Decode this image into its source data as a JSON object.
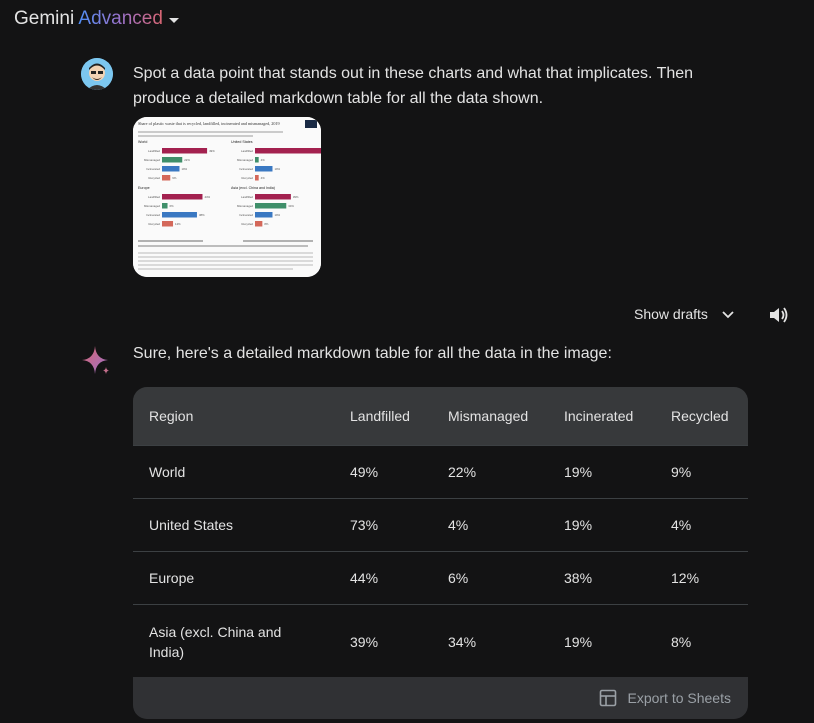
{
  "header": {
    "brand": "Gemini",
    "brand_advanced": "Advanced"
  },
  "prompt": {
    "text": "Spot a data point that stands out in these charts and what that implicates. Then produce a detailed markdown table for all the data shown."
  },
  "thumbnail": {
    "title": "Share of plastic waste that is recycled, landfilled, incinerated and mismanaged, 2019",
    "panels": [
      {
        "name": "World",
        "values": [
          49,
          22,
          19,
          9
        ]
      },
      {
        "name": "United States",
        "values": [
          73,
          4,
          19,
          4
        ]
      },
      {
        "name": "Europe",
        "values": [
          44,
          6,
          38,
          12
        ]
      },
      {
        "name": "Asia (excl. China and India)",
        "values": [
          39,
          34,
          19,
          8
        ]
      }
    ],
    "row_labels": [
      "Landfilled",
      "Mismanaged",
      "Incinerated",
      "Recycled"
    ],
    "colors": [
      "#a3214f",
      "#3f8f6a",
      "#3a78c2",
      "#d4685a"
    ]
  },
  "drafts": {
    "label": "Show drafts"
  },
  "response": {
    "text": "Sure, here's a detailed markdown table for all the data in the image:"
  },
  "table": {
    "headers": [
      "Region",
      "Landfilled",
      "Mismanaged",
      "Incinerated",
      "Recycled"
    ],
    "rows": [
      [
        "World",
        "49%",
        "22%",
        "19%",
        "9%"
      ],
      [
        "United States",
        "73%",
        "4%",
        "19%",
        "4%"
      ],
      [
        "Europe",
        "44%",
        "6%",
        "38%",
        "12%"
      ],
      [
        "Asia (excl. China and India)",
        "39%",
        "34%",
        "19%",
        "8%"
      ]
    ],
    "export_label": "Export to Sheets"
  }
}
